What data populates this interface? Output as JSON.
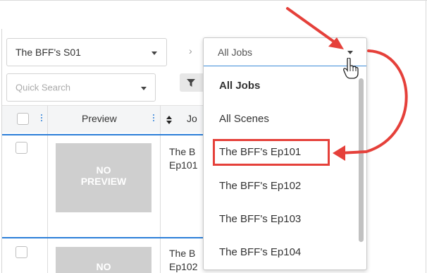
{
  "season_select": {
    "value": "The BFF's S01"
  },
  "breadcrumb_separator": "›",
  "quick_search": {
    "placeholder": "Quick Search"
  },
  "table": {
    "headers": {
      "preview": "Preview",
      "job": "Jo"
    },
    "rows": [
      {
        "preview_line1": "NO",
        "preview_line2": "PREVIEW",
        "job_line1": "The B",
        "job_line2": "Ep101"
      },
      {
        "preview_line1": "NO",
        "preview_line2": "",
        "job_line1": "The B",
        "job_line2": "Ep102"
      }
    ]
  },
  "job_dropdown": {
    "value": "All Jobs",
    "options": [
      {
        "label": "All Jobs",
        "bold": true
      },
      {
        "label": "All Scenes",
        "bold": false
      },
      {
        "label": "The BFF's Ep101",
        "bold": false,
        "highlighted": true
      },
      {
        "label": "The BFF's Ep102",
        "bold": false
      },
      {
        "label": "The BFF's Ep103",
        "bold": false
      },
      {
        "label": "The BFF's Ep104",
        "bold": false
      }
    ]
  },
  "colors": {
    "annotation_red": "#e5403a",
    "accent_blue": "#2d7fd8",
    "preview_gray": "#cfcfcf"
  },
  "icons": [
    "caret-down-icon",
    "filter-icon",
    "sort-icon",
    "kebab-icon",
    "hand-pointer-icon",
    "annotation-arrow"
  ]
}
